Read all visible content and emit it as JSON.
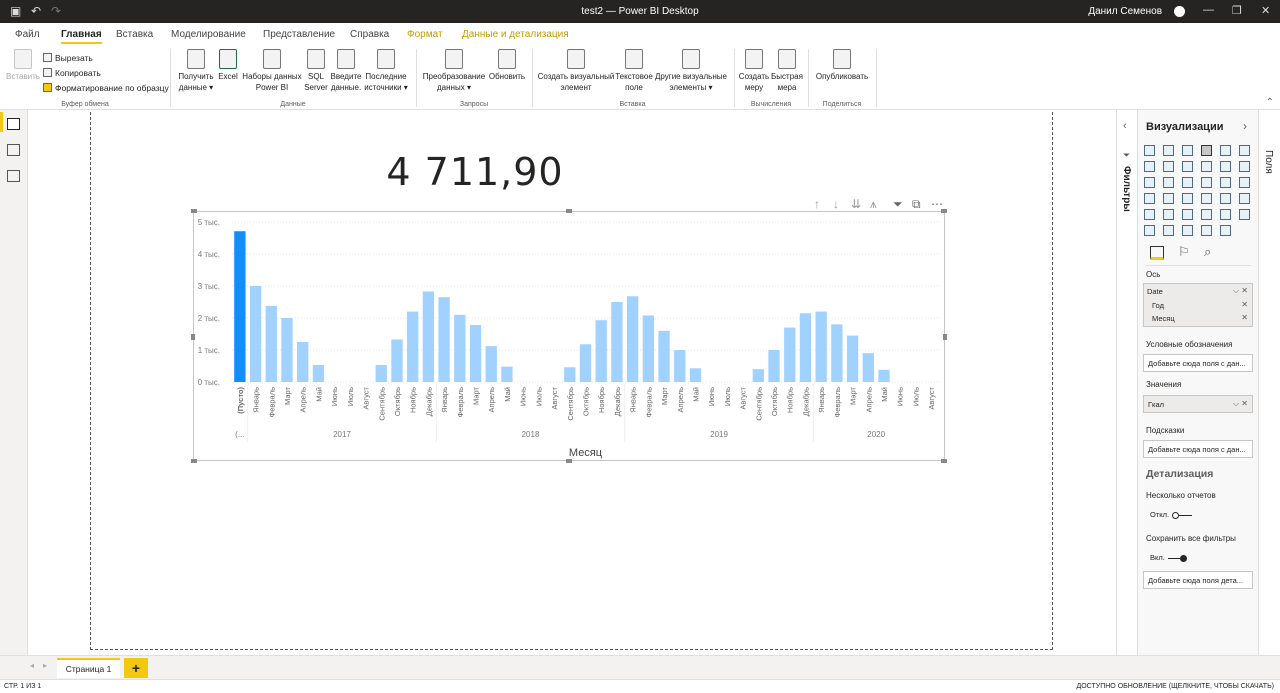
{
  "window": {
    "title": "test2 — Power BI Desktop",
    "user": "Данил Семенов"
  },
  "menu": {
    "tabs": [
      "Файл",
      "Главная",
      "Вставка",
      "Моделирование",
      "Представление",
      "Справка",
      "Формат",
      "Данные и детализация"
    ]
  },
  "ribbon": {
    "clipboard": {
      "paste": "Вставить",
      "cut": "Вырезать",
      "copy": "Копировать",
      "format_painter": "Форматирование по образцу",
      "group": "Буфер обмена"
    },
    "data": {
      "get_data": "Получить\nданные ▾",
      "excel": "Excel",
      "datasets": "Наборы данных\nPower BI",
      "sql": "SQL\nServer",
      "enter": "Введите\nданные.",
      "recent": "Последние\nисточники ▾",
      "group": "Данные"
    },
    "queries": {
      "transform": "Преобразование\nданных ▾",
      "refresh": "Обновить",
      "group": "Запросы"
    },
    "insert": {
      "new_visual": "Создать визуальный\nэлемент",
      "textbox": "Текстовое\nполе",
      "more_visuals": "Другие визуальные\nэлементы ▾",
      "group": "Вставка"
    },
    "calc": {
      "new_measure": "Создать\nмеру",
      "quick_measure": "Быстрая\nмера",
      "group": "Вычисления"
    },
    "share": {
      "publish": "Опубликовать",
      "group": "Поделиться"
    }
  },
  "card": {
    "value": "4 711,90"
  },
  "chart_data": {
    "type": "bar",
    "xlabel": "Месяц",
    "ylabel": "",
    "ylim": [
      0,
      5000
    ],
    "yticks": [
      "0 тыс.",
      "1 тыс.",
      "2 тыс.",
      "3 тыс.",
      "4 тыс.",
      "5 тыс."
    ],
    "grid": true,
    "categories": [
      "(Пусто)",
      "Январь",
      "Февраль",
      "Март",
      "Апрель",
      "Май",
      "Июнь",
      "Июль",
      "Август",
      "Сентябрь",
      "Октябрь",
      "Ноябрь",
      "Декабрь",
      "Январь",
      "Февраль",
      "Март",
      "Апрель",
      "Май",
      "Июнь",
      "Июль",
      "Август",
      "Сентябрь",
      "Октябрь",
      "Ноябрь",
      "Декабрь",
      "Январь",
      "Февраль",
      "Март",
      "Апрель",
      "Май",
      "Июнь",
      "Июль",
      "Август",
      "Сентябрь",
      "Октябрь",
      "Ноябрь",
      "Декабрь",
      "Январь",
      "Февраль",
      "Март",
      "Апрель",
      "Май",
      "Июнь",
      "Июль",
      "Август"
    ],
    "values": [
      4712,
      3000,
      2380,
      2000,
      1250,
      530,
      0,
      0,
      0,
      530,
      1330,
      2200,
      2830,
      2650,
      2100,
      1780,
      1120,
      480,
      0,
      0,
      0,
      460,
      1180,
      1930,
      2500,
      2680,
      2080,
      1600,
      1000,
      430,
      0,
      0,
      0,
      400,
      1000,
      1700,
      2150,
      2200,
      1800,
      1450,
      900,
      380,
      0,
      0,
      0
    ],
    "year_groups": [
      {
        "label": "(...",
        "start": 0,
        "end": 0
      },
      {
        "label": "2017",
        "start": 1,
        "end": 12
      },
      {
        "label": "2018",
        "start": 13,
        "end": 24
      },
      {
        "label": "2019",
        "start": 25,
        "end": 36
      },
      {
        "label": "2020",
        "start": 37,
        "end": 44
      }
    ],
    "colors": {
      "highlight": "#118dff",
      "bar": "#a1d1ff"
    }
  },
  "filters_pane": {
    "label": "Фильтры"
  },
  "fields_pane": {
    "label": "Поля"
  },
  "viz_pane": {
    "title": "Визуализации",
    "axis_label": "Ось",
    "axis_fields": [
      "Date",
      "Год",
      "Месяц"
    ],
    "legend_label": "Условные обозначения",
    "legend_placeholder": "Добавьте сюда поля с дан...",
    "values_label": "Значения",
    "values_field": "Гкал",
    "tooltips_label": "Подсказки",
    "tooltips_placeholder": "Добавьте сюда поля с дан...",
    "drill_title": "Детализация",
    "cross_report": "Несколько отчетов",
    "cross_report_state": "Откл.",
    "keep_filters": "Сохранить все фильтры",
    "keep_filters_state": "Вкл.",
    "drill_placeholder": "Добавьте сюда поля дета..."
  },
  "pages": {
    "tab": "Страница 1"
  },
  "status": {
    "left": "СТР. 1 ИЗ 1",
    "right": "ДОСТУПНО ОБНОВЛЕНИЕ (ЩЕЛКНИТЕ, ЧТОБЫ СКАЧАТЬ)"
  }
}
